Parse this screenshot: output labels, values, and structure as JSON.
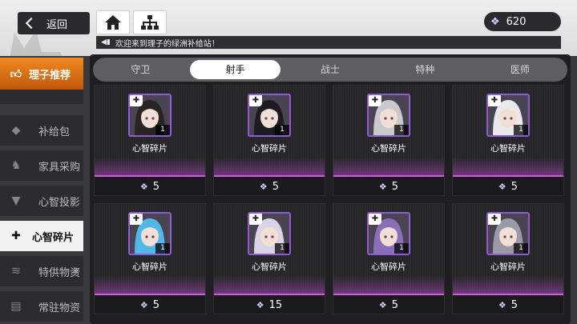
{
  "header": {
    "back_label": "返回",
    "home_icon": "home-icon",
    "hierarchy_icon": "hierarchy-icon",
    "currency_value": "620",
    "currency_icon": "diamond-gem-icon",
    "notice_text": "欢迎来到理子的绿洲补给站！"
  },
  "sidebar": {
    "items": [
      {
        "label": "理子推荐",
        "icon": "thumbs-up-icon"
      },
      {
        "label": "补给包",
        "icon": "box-icon"
      },
      {
        "label": "家具采购",
        "icon": "bunny-icon"
      },
      {
        "label": "心智投影",
        "icon": "shirt-icon"
      },
      {
        "label": "心智碎片",
        "icon": "puzzle-icon"
      },
      {
        "label": "特供物资",
        "icon": "layers-icon"
      },
      {
        "label": "常驻物资",
        "icon": "crate-icon"
      }
    ]
  },
  "tabs": [
    {
      "label": "守卫"
    },
    {
      "label": "射手"
    },
    {
      "label": "战士"
    },
    {
      "label": "特种"
    },
    {
      "label": "医师"
    }
  ],
  "cards": [
    {
      "name": "心智碎片",
      "price": "5",
      "count": "1",
      "hair": "#2b2424"
    },
    {
      "name": "心智碎片",
      "price": "5",
      "count": "1",
      "hair": "#1d1c22"
    },
    {
      "name": "心智碎片",
      "price": "5",
      "count": "1",
      "hair": "#c9c9cc"
    },
    {
      "name": "心智碎片",
      "price": "5",
      "count": "1",
      "hair": "#e9e9ec"
    },
    {
      "name": "心智碎片",
      "price": "5",
      "count": "1",
      "hair": "#4fb8e8"
    },
    {
      "name": "心智碎片",
      "price": "15",
      "count": "1",
      "hair": "#d7d5e6"
    },
    {
      "name": "心智碎片",
      "price": "5",
      "count": "1",
      "hair": "#8a6fb8"
    },
    {
      "name": "心智碎片",
      "price": "5",
      "count": "1",
      "hair": "#9a9aa6"
    }
  ]
}
